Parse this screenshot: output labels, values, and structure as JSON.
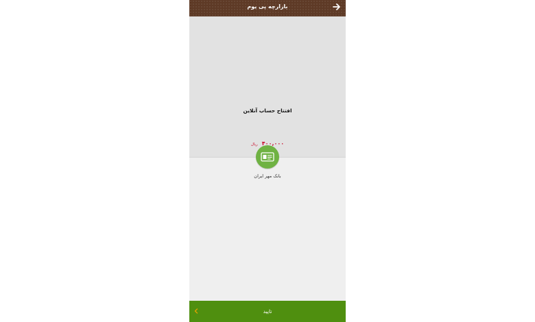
{
  "header": {
    "title": "بازارچه پی یوم",
    "back_icon": "arrow-right-icon"
  },
  "service": {
    "title": "افتتاح حساب آنلاین",
    "price_amount": "۴۰۰,۰۰۰",
    "price_unit": "ریال"
  },
  "bank": {
    "name": "بانک مهر ایران",
    "icon": "bank-card-icon"
  },
  "footer": {
    "confirm_label": "تایید",
    "chevron_icon": "chevron-left-icon"
  },
  "colors": {
    "header_bg": "#5e3a26",
    "footer_bg": "#4f8f0f",
    "bank_icon_bg": "#6fb243",
    "price": "#c8102e"
  }
}
